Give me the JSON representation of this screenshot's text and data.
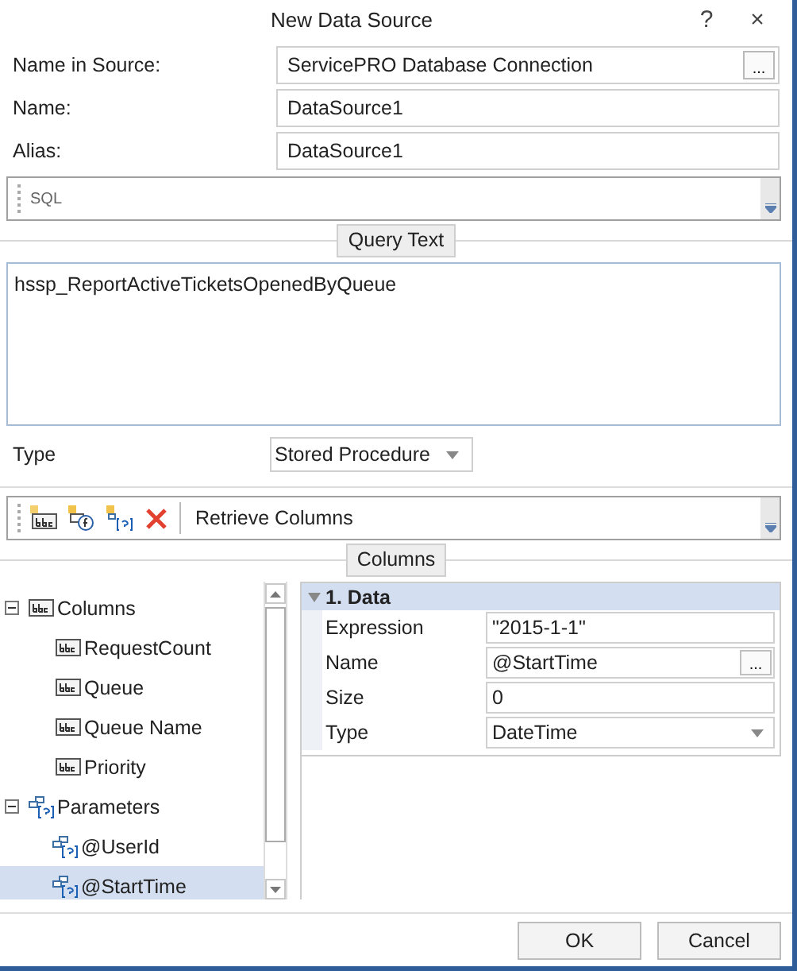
{
  "window": {
    "title": "New Data Source",
    "help": "?",
    "close": "×"
  },
  "fields": [
    {
      "label": "Name in Source:",
      "value": "ServicePRO Database Connection",
      "browse": "..."
    },
    {
      "label": "Name:",
      "value": "DataSource1"
    },
    {
      "label": "Alias:",
      "value": "DataSource1"
    }
  ],
  "sql_toolbar": {
    "label": "SQL"
  },
  "query_text": {
    "heading": "Query Text",
    "value": "hssp_ReportActiveTicketsOpenedByQueue"
  },
  "type": {
    "label": "Type",
    "value": "Stored Procedure"
  },
  "columns_toolbar": {
    "action": "Retrieve Columns"
  },
  "columns_heading": "Columns",
  "tree": [
    {
      "label": "Columns",
      "kind": "column",
      "expanded": true,
      "selected": false,
      "children": [
        {
          "label": "RequestCount",
          "kind": "column",
          "selected": false
        },
        {
          "label": "Queue",
          "kind": "column",
          "selected": false
        },
        {
          "label": "Queue Name",
          "kind": "column",
          "selected": false
        },
        {
          "label": "Priority",
          "kind": "column",
          "selected": false
        }
      ]
    },
    {
      "label": "Parameters",
      "kind": "parameter",
      "expanded": true,
      "selected": false,
      "children": [
        {
          "label": "@UserId",
          "kind": "parameter",
          "selected": false
        },
        {
          "label": "@StartTime",
          "kind": "parameter",
          "selected": true
        }
      ]
    }
  ],
  "properties": {
    "category": "1. Data",
    "expanded": true,
    "rows": [
      {
        "label": "Expression",
        "value": "\"2015-1-1\"",
        "kind": "text"
      },
      {
        "label": "Name",
        "value": "@StartTime",
        "kind": "browse",
        "browse": "..."
      },
      {
        "label": "Size",
        "value": "0",
        "kind": "text"
      },
      {
        "label": "Type",
        "value": "DateTime",
        "kind": "dropdown"
      }
    ]
  },
  "buttons": [
    "OK",
    "Cancel"
  ]
}
